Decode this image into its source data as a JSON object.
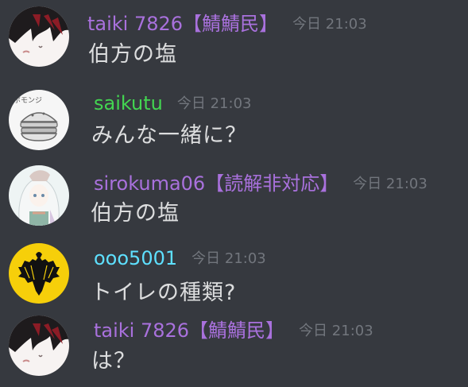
{
  "colors": {
    "background": "#36393f",
    "timestamp": "#72767d",
    "message_text": "#dcddde",
    "role_purple": "#a971dd",
    "role_green": "#43d651",
    "role_cyan": "#5ee0ff"
  },
  "messages": [
    {
      "username": "taiki 7826【鯖鯖民】",
      "timestamp": "今日 21:03",
      "content": "伯方の塩",
      "name_color": "#a971dd",
      "avatar_icon": "anime-face-avatar-icon"
    },
    {
      "username": "saikutu",
      "timestamp": "今日 21:03",
      "content": "みんな一緒に？",
      "name_color": "#43d651",
      "avatar_icon": "burger-sketch-avatar-icon"
    },
    {
      "username": "sirokuma06【読解非対応】",
      "timestamp": "今日 21:03",
      "content": "伯方の塩",
      "name_color": "#a971dd",
      "avatar_icon": "white-hair-girl-avatar-icon"
    },
    {
      "username": "ooo5001",
      "timestamp": "今日 21:03",
      "content": "トイレの種類?",
      "name_color": "#5ee0ff",
      "avatar_icon": "eagle-crest-avatar-icon"
    },
    {
      "username": "taiki 7826【鯖鯖民】",
      "timestamp": "今日 21:03",
      "content": "は？",
      "name_color": "#a971dd",
      "avatar_icon": "anime-face-avatar-icon"
    }
  ]
}
